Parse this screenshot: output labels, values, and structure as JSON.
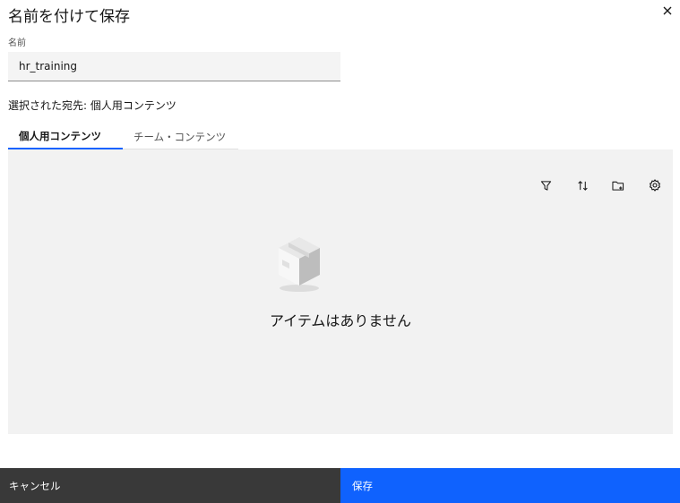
{
  "dialog": {
    "title": "名前を付けて保存",
    "close_icon": "close-icon"
  },
  "name_field": {
    "label": "名前",
    "value": "hr_training"
  },
  "destination_text": "選択された宛先: 個人用コンテンツ",
  "tabs": [
    {
      "label": "個人用コンテンツ",
      "active": true
    },
    {
      "label": "チーム・コンテンツ",
      "active": false
    }
  ],
  "toolbar": {
    "icons": [
      "filter-icon",
      "sort-icon",
      "new-folder-icon",
      "settings-icon"
    ]
  },
  "empty_state": {
    "icon": "empty-box-icon",
    "message": "アイテムはありません"
  },
  "footer": {
    "cancel_label": "キャンセル",
    "save_label": "保存"
  },
  "colors": {
    "accent": "#0f62fe",
    "cancel_bg": "#393939",
    "panel_bg": "#f2f2f2"
  }
}
